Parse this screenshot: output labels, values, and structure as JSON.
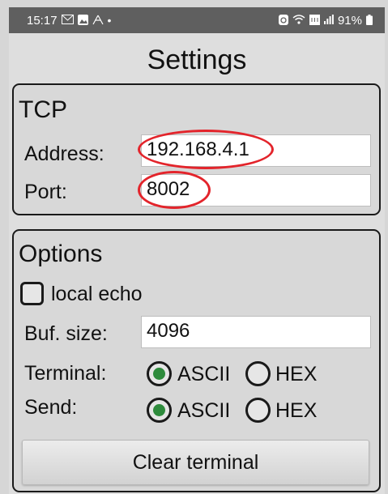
{
  "status_bar": {
    "time": "15:17",
    "left_icons": [
      "mail-icon",
      "image-icon",
      "signal-app-icon",
      "dot-icon"
    ],
    "battery": "91%",
    "right_icons": [
      "alarm-icon",
      "wifi-icon",
      "data-icon",
      "signal-icon",
      "battery-icon"
    ]
  },
  "title": "Settings",
  "tcp": {
    "heading": "TCP",
    "address_label": "Address:",
    "address_value": "192.168.4.1",
    "port_label": "Port:",
    "port_value": "8002"
  },
  "options": {
    "heading": "Options",
    "local_echo_label": "local echo",
    "local_echo_checked": false,
    "buf_size_label": "Buf. size:",
    "buf_size_value": "4096",
    "terminal_label": "Terminal:",
    "terminal_selected": "ASCII",
    "send_label": "Send:",
    "send_selected": "ASCII",
    "radio_ascii": "ASCII",
    "radio_hex": "HEX"
  },
  "clear_terminal": "Clear terminal",
  "colors": {
    "status_bar": "#5f5f5f",
    "background": "#dedede",
    "radio_selected": "#2e8b3c",
    "annotation": "#e3242b"
  }
}
